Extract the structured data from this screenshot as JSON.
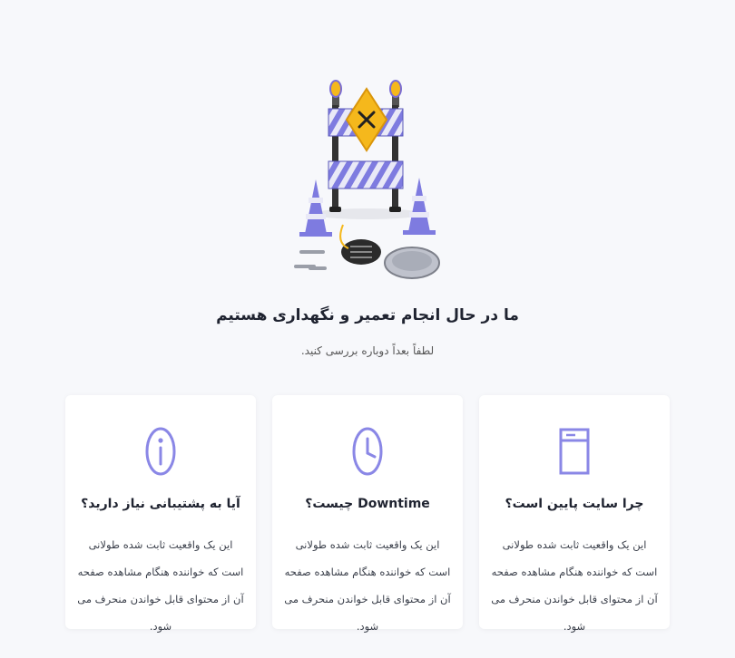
{
  "hero": {
    "title": "ما در حال انجام تعمیر و نگهداری هستیم",
    "subtitle": "لطفاً بعداً دوباره بررسی کنید."
  },
  "cards": [
    {
      "title": "آیا به پشتیبانی نیاز دارید؟",
      "body": "این یک واقعیت ثابت شده طولانی است که خواننده هنگام مشاهده صفحه آن از محتوای قابل خواندن منحرف می شود.",
      "icon": "info-icon"
    },
    {
      "title": "Downtime چیست؟",
      "body": "این یک واقعیت ثابت شده طولانی است که خواننده هنگام مشاهده صفحه آن از محتوای قابل خواندن منحرف می شود.",
      "icon": "clock-icon"
    },
    {
      "title": "چرا سایت پایین است؟",
      "body": "این یک واقعیت ثابت شده طولانی است که خواننده هنگام مشاهده صفحه آن از محتوای قابل خواندن منحرف می شود.",
      "icon": "browser-window-icon"
    }
  ],
  "colors": {
    "accent": "#8a87e6",
    "background": "#f7f8fb",
    "card": "#ffffff",
    "sign": "#f5b81c"
  }
}
